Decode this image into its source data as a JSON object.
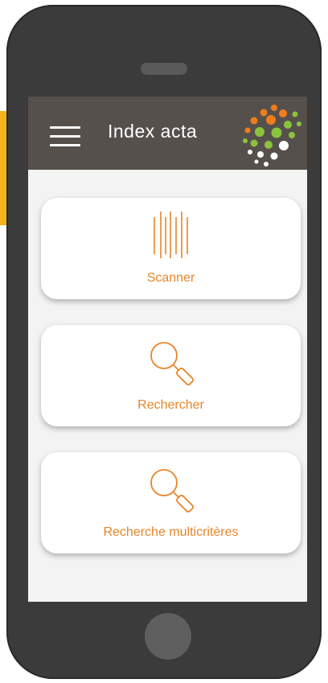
{
  "app": {
    "title": "Index acta"
  },
  "menu": {
    "icon": "hamburger-menu-icon"
  },
  "cards": [
    {
      "label": "Scanner",
      "icon": "barcode-icon"
    },
    {
      "label": "Rechercher",
      "icon": "magnifier-icon"
    },
    {
      "label": "Recherche multicritères",
      "icon": "magnifier-icon"
    }
  ],
  "colors": {
    "accent": "#e6862a",
    "appbar": "#55504c",
    "screen_background": "#f3f3f3",
    "phone_body": "#3b3b3b",
    "logo_orange": "#f07d1c",
    "logo_green": "#8bc33c",
    "logo_white": "#ffffff"
  }
}
